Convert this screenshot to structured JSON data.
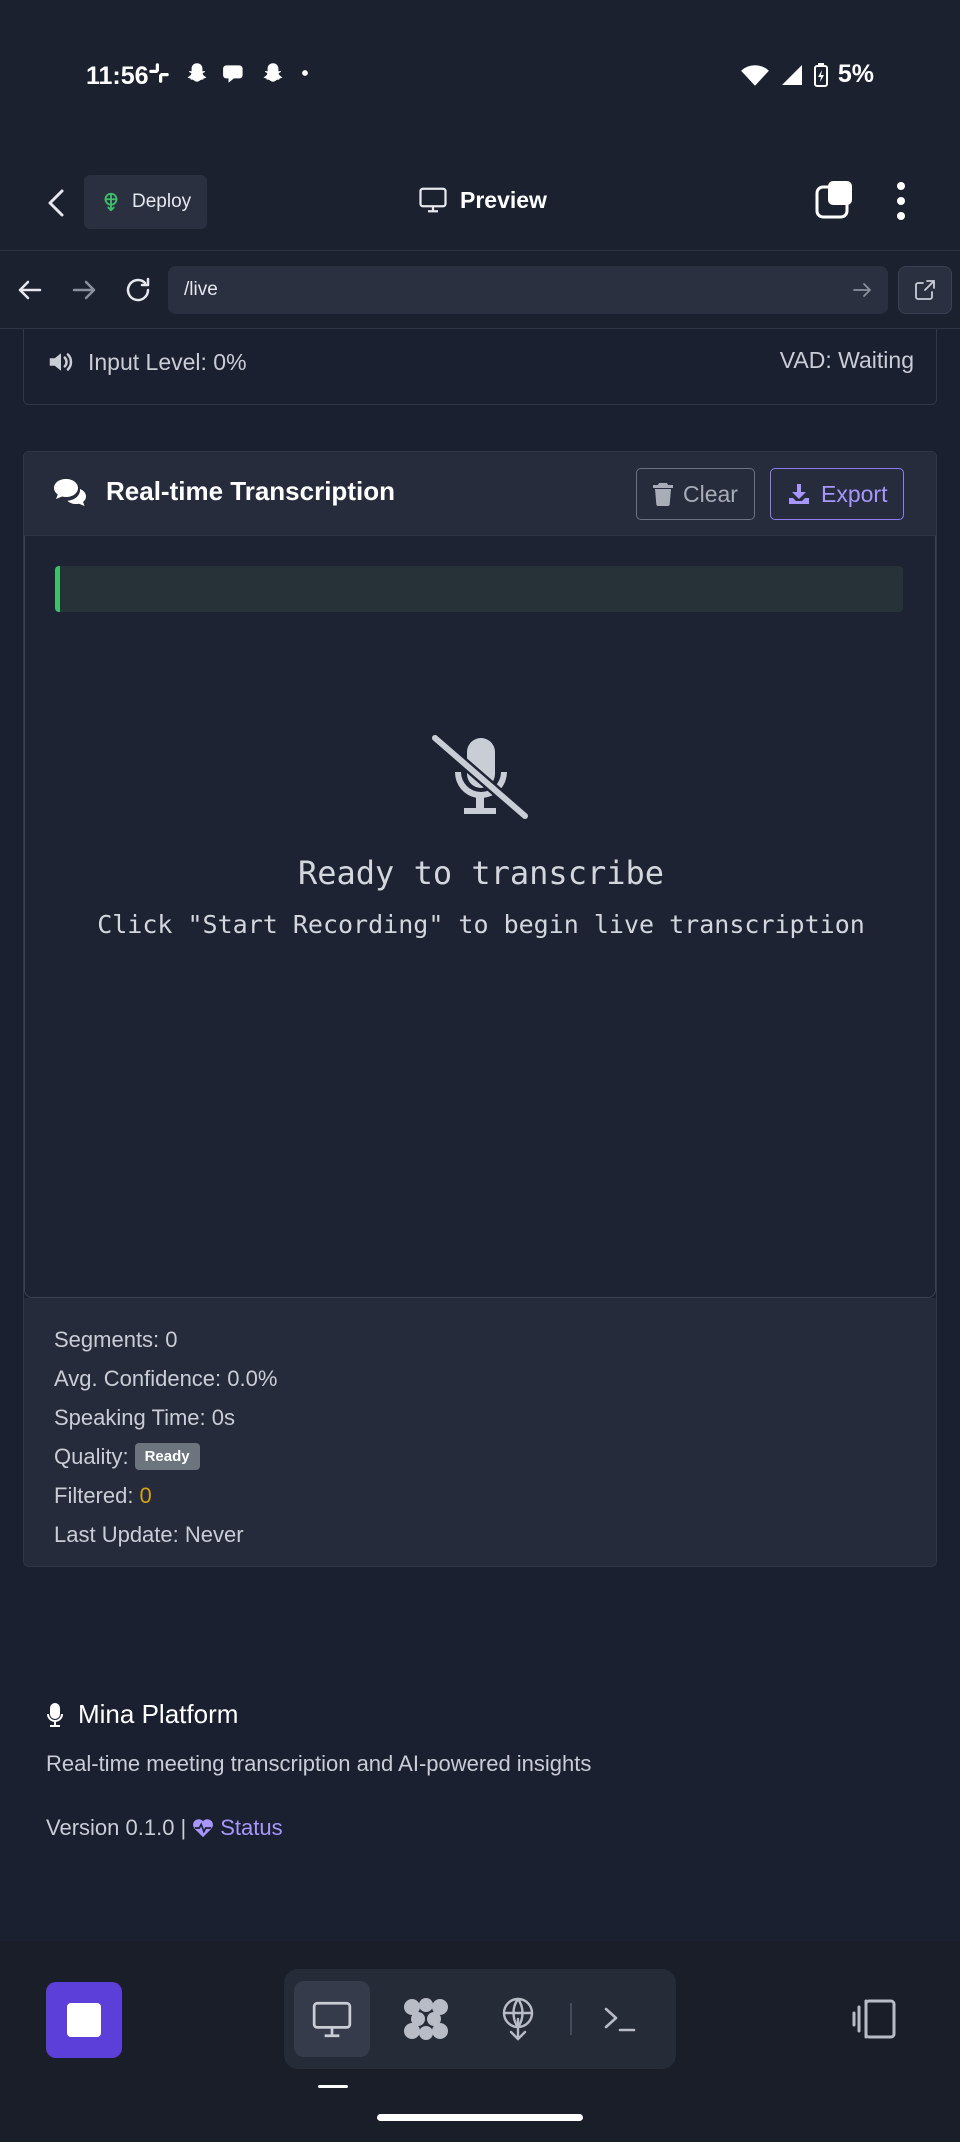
{
  "status_bar": {
    "time": "11:56",
    "battery": "5%",
    "notification_icons": [
      "slack-icon",
      "snapchat-icon",
      "chat-icon",
      "snapchat-icon",
      "dot-icon"
    ]
  },
  "app_bar": {
    "deploy_label": "Deploy",
    "preview_label": "Preview"
  },
  "url_bar": {
    "url": "/live"
  },
  "input_level": {
    "label": "Input Level: 0%",
    "vad": "VAD: Waiting"
  },
  "transcription": {
    "title": "Real-time Transcription",
    "clear_label": "Clear",
    "export_label": "Export",
    "empty_title": "Ready to transcribe",
    "empty_subtitle": "Click \"Start Recording\" to begin live transcription"
  },
  "stats": {
    "segments": "Segments: 0",
    "avg_confidence": "Avg. Confidence: 0.0%",
    "speaking_time": "Speaking Time: 0s",
    "quality_label": "Quality:",
    "quality_badge": "Ready",
    "filtered_label": "Filtered:",
    "filtered_value": "0",
    "last_update": "Last Update: Never"
  },
  "footer": {
    "title": "Mina Platform",
    "description": "Real-time meeting transcription and AI-powered insights",
    "version": "Version 0.1.0 |",
    "status_link": "Status"
  },
  "colors": {
    "accent": "#5b3fd8",
    "export": "#a796ff",
    "live_bar": "#3fbf6b",
    "filtered": "#d4a017"
  }
}
